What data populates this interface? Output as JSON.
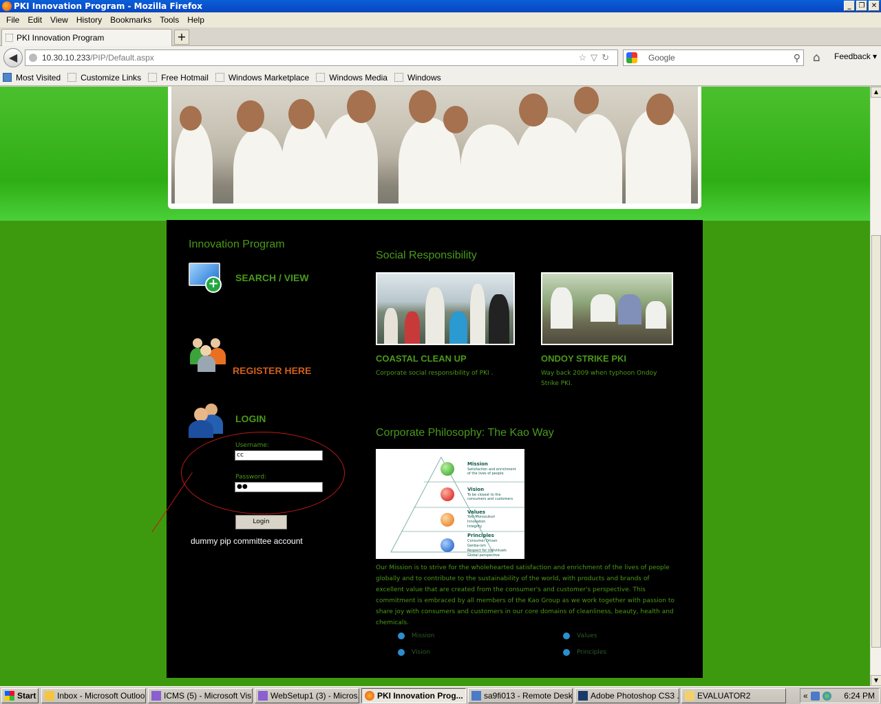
{
  "window": {
    "title": "PKI Innovation Program - Mozilla Firefox",
    "controls": [
      "_",
      "❐",
      "✕"
    ]
  },
  "menu": [
    "File",
    "Edit",
    "View",
    "History",
    "Bookmarks",
    "Tools",
    "Help"
  ],
  "tab": {
    "label": "PKI Innovation Program",
    "new_tab": "+"
  },
  "address": {
    "host": "10.30.10.233",
    "path": "/PIP/Default.aspx"
  },
  "search": {
    "placeholder": "Google"
  },
  "feedback": "Feedback",
  "bookmarks": [
    "Most Visited",
    "Customize Links",
    "Free Hotmail",
    "Windows Marketplace",
    "Windows Media",
    "Windows"
  ],
  "page": {
    "innovation_title": "Innovation Program",
    "search_view": "SEARCH / VIEW",
    "register": "REGISTER HERE",
    "login": "LOGIN",
    "username_label": "Username:",
    "username_value": "cc",
    "password_label": "Password:",
    "password_value": "●●",
    "login_button": "Login",
    "annotation": "dummy pip committee account",
    "social_title": "Social Responsibility",
    "coastal_title": "COASTAL CLEAN UP",
    "coastal_desc": "Corporate social responsibility of PKI .",
    "ondoy_title": "ONDOY STRIKE PKI",
    "ondoy_desc": "Way back 2009 when typhoon Ondoy Strike PKI.",
    "philosophy_title": "Corporate Philosophy: The Kao Way",
    "pyramid": {
      "mission": "Mission",
      "vision": "Vision",
      "values": "Values",
      "principles": "Principles",
      "mission_lines": [
        "Satisfaction and enrichment",
        "of the lives of people"
      ],
      "vision_lines": [
        "To be closest to the",
        "consumers and customers"
      ],
      "values_lines": [
        "Yoki-Monozukuri",
        "Innovation",
        "Integrity"
      ],
      "principles_lines": [
        "Consumer Driven",
        "Genba-ism",
        "Respect for individuals",
        "Global perspective"
      ]
    },
    "mission_text": "Our Mission is to strive for the wholehearted satisfaction and enrichment of the lives of people globally and to contribute to the sustainability of the world, with products and brands of excellent value that are created from the consumer's  and customer's perspective. This commitment  is embraced  by all members of  the Kao Group  as we work together with passion to share joy with consumers and customers in our core domains of cleanliness, beauty, health and chemicals.",
    "links": [
      "Mission",
      "Values",
      "Vision",
      "Principles"
    ]
  },
  "taskbar": {
    "start": "Start",
    "items": [
      "Inbox - Microsoft Outlook",
      "ICMS (5) - Microsoft Vis...",
      "WebSetup1 (3) - Micros...",
      "PKI Innovation Prog...",
      "sa9fi013 - Remote Desk...",
      "Adobe Photoshop CS3 ...",
      "EVALUATOR2"
    ],
    "tray_expand": "«",
    "clock": "6:24 PM"
  },
  "colors": {
    "accent_green": "#4a9a1a",
    "register_orange": "#d0601a",
    "page_green": "#3d9a0e",
    "panel": "#000000"
  }
}
